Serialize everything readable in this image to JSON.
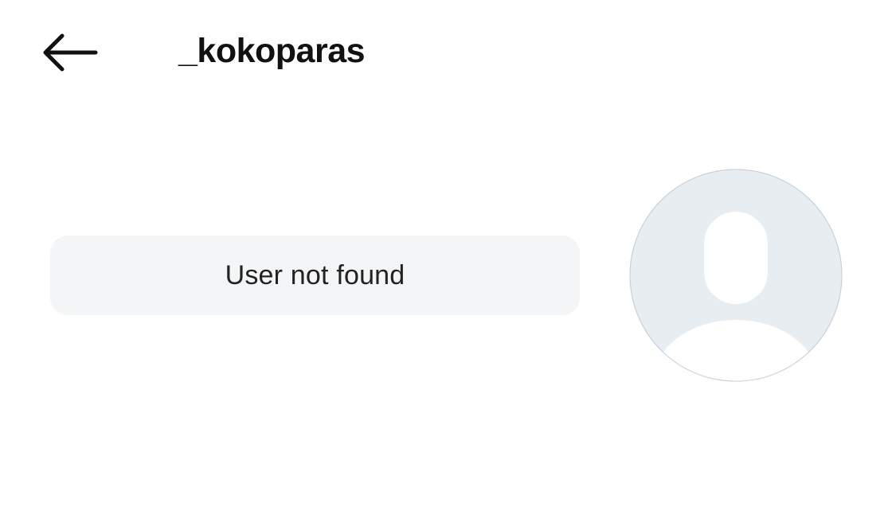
{
  "header": {
    "back_icon": "arrow-left-icon",
    "username": "_kokoparas"
  },
  "profile": {
    "status_message": "User not found",
    "avatar_icon": "default-avatar-icon"
  },
  "colors": {
    "avatar_bg": "#e8edf2",
    "avatar_figure": "#ffffff",
    "pill_bg": "#f4f5f6",
    "text": "#111111"
  }
}
